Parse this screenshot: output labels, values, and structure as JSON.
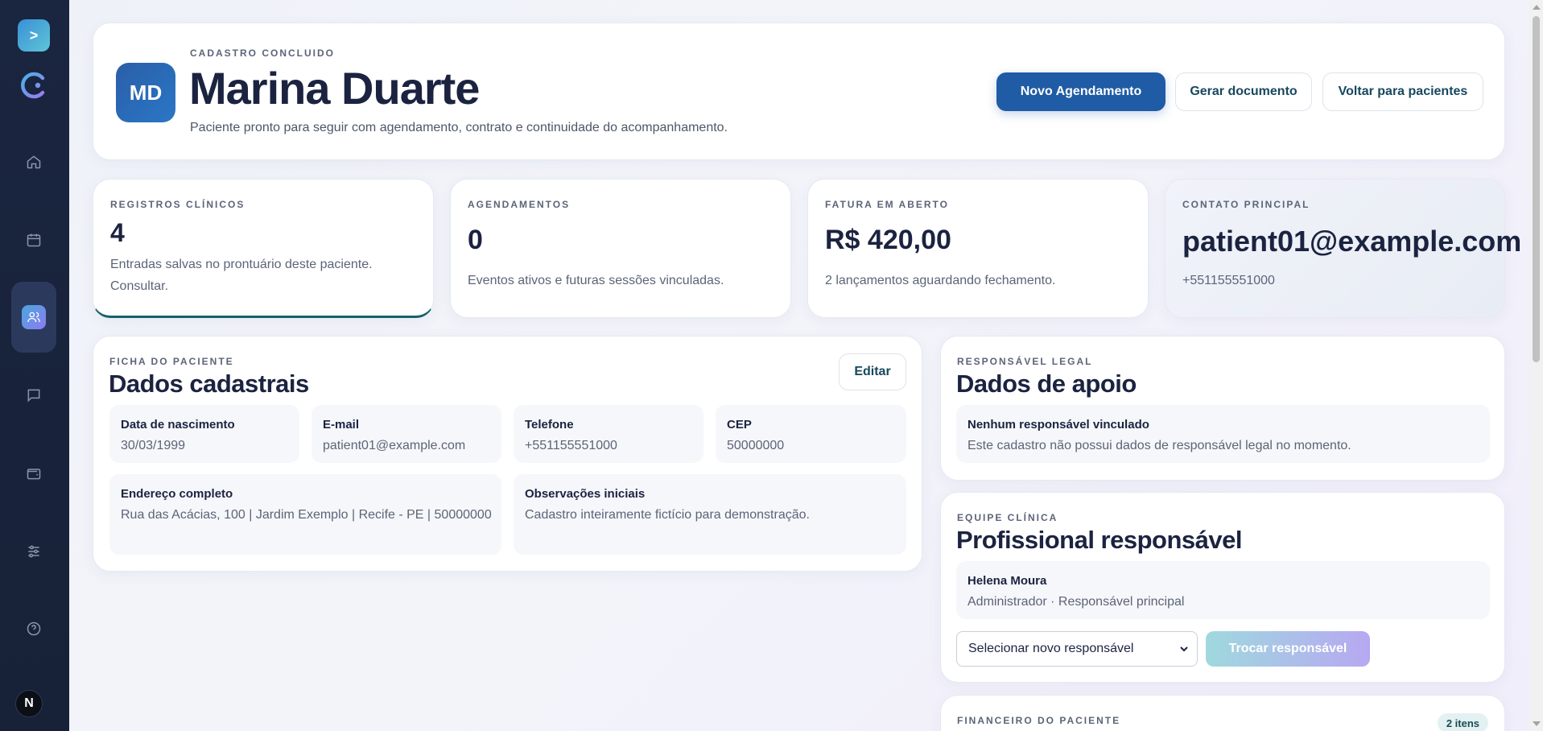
{
  "sidebar": {
    "toggle_label": ">",
    "user_initial": "N",
    "items": [
      {
        "icon": "home-icon"
      },
      {
        "icon": "calendar-icon"
      },
      {
        "icon": "users-icon",
        "active": true
      },
      {
        "icon": "message-icon"
      },
      {
        "icon": "wallet-icon"
      },
      {
        "icon": "sliders-icon"
      },
      {
        "icon": "help-icon"
      }
    ]
  },
  "header": {
    "eyebrow": "CADASTRO CONCLUIDO",
    "initials": "MD",
    "name": "Marina Duarte",
    "subtitle": "Paciente pronto para seguir com agendamento, contrato e continuidade do acompanhamento.",
    "btn_new": "Novo Agendamento",
    "btn_doc": "Gerar documento",
    "btn_back": "Voltar para pacientes"
  },
  "stats": {
    "registros": {
      "eyebrow": "REGISTROS CLÍNICOS",
      "value": "4",
      "desc": "Entradas salvas no prontuário deste paciente. Consultar."
    },
    "agendamentos": {
      "eyebrow": "AGENDAMENTOS",
      "value": "0",
      "desc": "Eventos ativos e futuras sessões vinculadas."
    },
    "fatura": {
      "eyebrow": "FATURA EM ABERTO",
      "value": "R$ 420,00",
      "desc": "2 lançamentos aguardando fechamento."
    },
    "contato": {
      "eyebrow": "CONTATO PRINCIPAL",
      "value": "patient01@example.com",
      "desc": "+551155551000"
    }
  },
  "ficha": {
    "eyebrow": "FICHA DO PACIENTE",
    "title": "Dados cadastrais",
    "edit_label": "Editar",
    "fields": {
      "nascimento": {
        "label": "Data de nascimento",
        "value": "30/03/1999"
      },
      "email": {
        "label": "E-mail",
        "value": "patient01@example.com"
      },
      "telefone": {
        "label": "Telefone",
        "value": "+551155551000"
      },
      "cep": {
        "label": "CEP",
        "value": "50000000"
      },
      "endereco": {
        "label": "Endereço completo",
        "value": "Rua das Acácias, 100 | Jardim Exemplo | Recife - PE | 50000000"
      },
      "observacoes": {
        "label": "Observações iniciais",
        "value": "Cadastro inteiramente fictício para demonstração."
      }
    }
  },
  "apoio": {
    "eyebrow": "RESPONSÁVEL LEGAL",
    "title": "Dados de apoio",
    "box_title": "Nenhum responsável vinculado",
    "box_text": "Este cadastro não possui dados de responsável legal no momento."
  },
  "equipe": {
    "eyebrow": "EQUIPE CLÍNICA",
    "title": "Profissional responsável",
    "name": "Helena Moura",
    "role": "Administrador · Responsável principal",
    "select_value": "Selecionar novo responsável",
    "btn_label": "Trocar responsável"
  },
  "financeiro": {
    "eyebrow": "FINANCEIRO DO PACIENTE",
    "badge": "2 itens"
  }
}
